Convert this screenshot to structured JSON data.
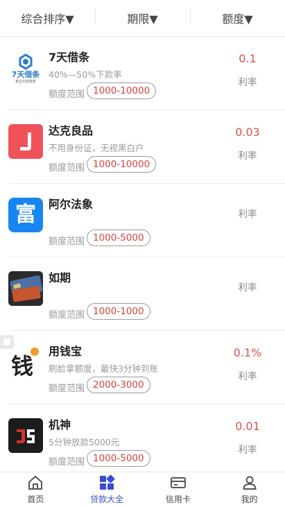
{
  "filters": [
    {
      "label": "综合排序▼"
    },
    {
      "label": "期限▼"
    },
    {
      "label": "额度▼"
    }
  ],
  "range_label": "额度范围",
  "rate_label": "利率",
  "items": [
    {
      "name": "7天借条",
      "desc": "40%—50%下款率",
      "range": "1000-10000",
      "rate": "0.1",
      "logo_icon": "7tian-jietiao-logo",
      "logo_text": "7天借条",
      "logo_subtext": "真正的放款款"
    },
    {
      "name": "达克良品",
      "desc": "不用身份证，无视黑白户",
      "range": "1000-10000",
      "rate": "0.03",
      "logo_icon": "dake-liangpin-logo"
    },
    {
      "name": "阿尔法象",
      "desc": "",
      "range": "1000-5000",
      "rate": "",
      "logo_icon": "aerfaxiang-logo",
      "logo_text": "富"
    },
    {
      "name": "如期",
      "desc": "",
      "range": "1000-1000",
      "rate": "",
      "logo_icon": "ruqi-card-logo"
    },
    {
      "name": "用钱宝",
      "desc": "刷脸拿额度，最快3分钟到账",
      "range": "2000-3000",
      "rate": "0.1%",
      "logo_icon": "yongqianbao-logo",
      "logo_text": "钱"
    },
    {
      "name": "机神",
      "desc": "5分钟放款5000元",
      "range": "1000-5000",
      "rate": "0.01",
      "logo_icon": "jishen-logo"
    }
  ],
  "tabs": [
    {
      "label": "首页",
      "icon": "home-icon",
      "active": false
    },
    {
      "label": "贷款大全",
      "icon": "grid-icon",
      "active": true
    },
    {
      "label": "信用卡",
      "icon": "credit-card-icon",
      "active": false
    },
    {
      "label": "我的",
      "icon": "user-icon",
      "active": false
    }
  ],
  "colors": {
    "accent": "#3a4bd6",
    "rate": "#e0524c",
    "pill_text": "#d8413b"
  }
}
